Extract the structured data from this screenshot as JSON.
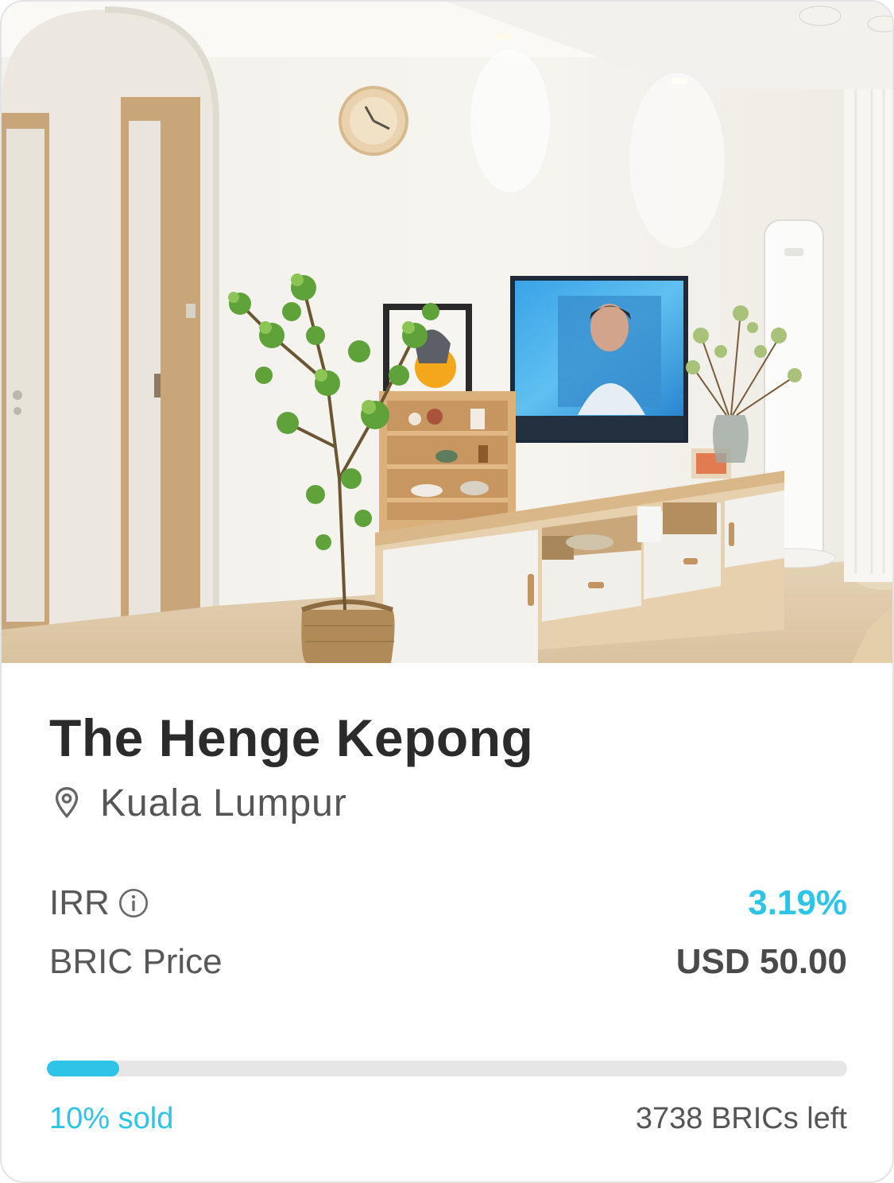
{
  "property": {
    "name": "The Henge Kepong",
    "location": "Kuala Lumpur",
    "photo_description_icon": "living-room-photo"
  },
  "metrics": {
    "irr_label": "IRR",
    "irr_value": "3.19%",
    "price_label": "BRIC Price",
    "price_value": "USD 50.00"
  },
  "progress": {
    "sold_fraction": 0.09,
    "sold_text": "10% sold",
    "left_text": "3738 BRICs left"
  },
  "colors": {
    "accent": "#2ec4e8",
    "title": "#2b2b2b",
    "muted": "#555555",
    "track": "#e6e6e6"
  },
  "icons": {
    "location": "map-pin-icon",
    "info": "info-circle-icon"
  }
}
